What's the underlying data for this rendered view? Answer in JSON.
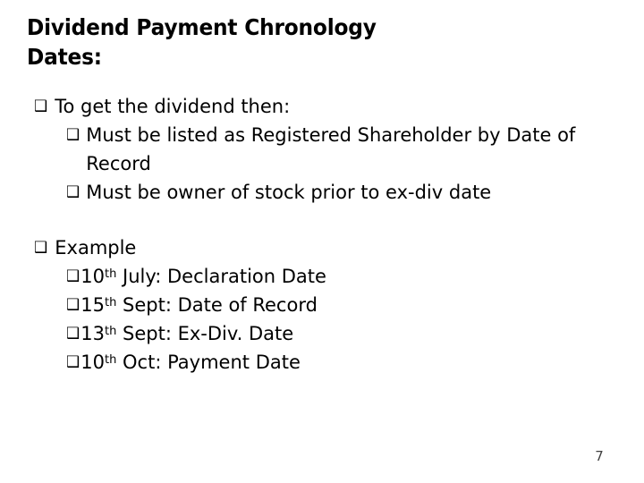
{
  "slide": {
    "title": {
      "line1": "Dividend Payment Chronology",
      "line2": "Dates:"
    },
    "bullet_glyph": "❑",
    "sections": [
      {
        "heading": "To get the dividend then:",
        "items": [
          "Must be listed as Registered Shareholder by Date of Record",
          "Must be owner of stock prior to ex-div date"
        ]
      },
      {
        "heading": "Example",
        "items": [
          {
            "day": "10",
            "ordinal": "th",
            "rest": " July: Declaration Date"
          },
          {
            "day": "15",
            "ordinal": "th",
            "rest": " Sept: Date of Record"
          },
          {
            "day": "13",
            "ordinal": "th",
            "rest": " Sept: Ex-Div. Date"
          },
          {
            "day": "10",
            "ordinal": "th",
            "rest": " Oct: Payment Date"
          }
        ]
      }
    ],
    "page_number": "7"
  }
}
